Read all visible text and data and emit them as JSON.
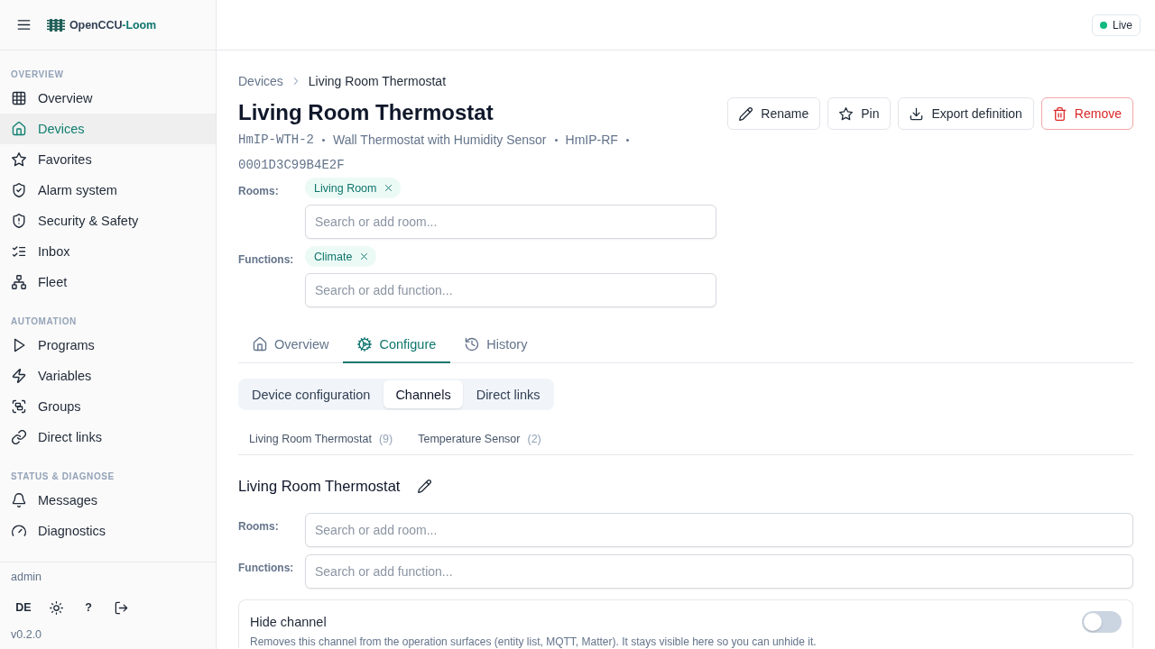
{
  "sidebar": {
    "brand": {
      "name": "OpenCCU",
      "accent": "-Loom"
    },
    "sections": [
      {
        "title": "OVERVIEW",
        "items": [
          {
            "label": "Overview",
            "selected": false
          },
          {
            "label": "Devices",
            "selected": true
          },
          {
            "label": "Favorites",
            "selected": false
          },
          {
            "label": "Alarm system",
            "selected": false
          },
          {
            "label": "Security & Safety",
            "selected": false
          },
          {
            "label": "Inbox",
            "selected": false
          },
          {
            "label": "Fleet",
            "selected": false
          }
        ]
      },
      {
        "title": "AUTOMATION",
        "items": [
          {
            "label": "Programs",
            "selected": false
          },
          {
            "label": "Variables",
            "selected": false
          },
          {
            "label": "Groups",
            "selected": false
          },
          {
            "label": "Direct links",
            "selected": false
          }
        ]
      },
      {
        "title": "STATUS & DIAGNOSE",
        "items": [
          {
            "label": "Messages",
            "selected": false
          },
          {
            "label": "Diagnostics",
            "selected": false
          }
        ]
      }
    ],
    "footer": {
      "user": "admin",
      "language": "DE",
      "help": "?",
      "version": "v0.2.0"
    }
  },
  "topbar": {
    "status": "Live"
  },
  "breadcrumb": [
    {
      "label": "Devices"
    },
    {
      "label": "Living Room Thermostat"
    }
  ],
  "device": {
    "title": "Living Room Thermostat",
    "meta": [
      {
        "text": "HmIP-WTH-2",
        "kind": "code"
      },
      {
        "text": "Wall Thermostat with Humidity Sensor",
        "kind": "text"
      },
      {
        "text": "HmIP-RF",
        "kind": "text"
      },
      {
        "text": "0001D3C99B4E2F",
        "kind": "code"
      }
    ],
    "actions": [
      {
        "label": "Rename",
        "kind": "default"
      },
      {
        "label": "Pin",
        "kind": "default"
      },
      {
        "label": "Export definition",
        "kind": "default"
      },
      {
        "label": "Remove",
        "kind": "danger"
      }
    ],
    "assignments": [
      {
        "label": "Rooms:",
        "chips": [
          "Living Room"
        ],
        "placeholder": "Search or add room..."
      },
      {
        "label": "Functions:",
        "chips": [
          "Climate"
        ],
        "placeholder": "Search or add function..."
      }
    ]
  },
  "tabs": [
    {
      "label": "Overview",
      "selected": false
    },
    {
      "label": "Configure",
      "selected": true
    },
    {
      "label": "History",
      "selected": false
    }
  ],
  "subtabs": [
    {
      "label": "Device configuration",
      "selected": false
    },
    {
      "label": "Channels",
      "selected": true
    },
    {
      "label": "Direct links",
      "selected": false
    }
  ],
  "channel_tabs": [
    {
      "label": "Living Room Thermostat",
      "count": "(9)",
      "selected": false
    },
    {
      "label": "Temperature Sensor",
      "count": "(2)",
      "selected": false
    }
  ],
  "channel": {
    "title": "Living Room Thermostat",
    "assignments": [
      {
        "label": "Rooms:",
        "placeholder": "Search or add room..."
      },
      {
        "label": "Functions:",
        "placeholder": "Search or add function..."
      }
    ],
    "settings": [
      {
        "kind": "toggle",
        "title": "Hide channel",
        "on": false,
        "description": "Removes this channel from the operation surfaces (entity list, MQTT, Matter). It stays visible here so you can unhide it."
      }
    ]
  }
}
